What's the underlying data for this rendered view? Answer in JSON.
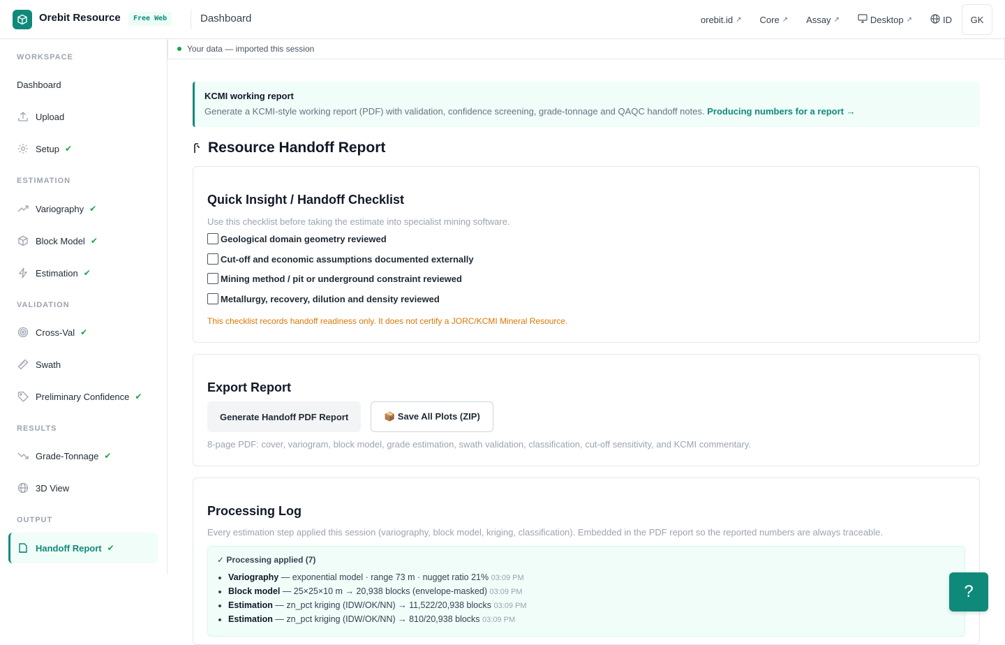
{
  "header": {
    "brand": "Orebit Resource",
    "plan_badge": "Free Web",
    "page": "Dashboard",
    "links": [
      {
        "label": "orebit.id",
        "ext": "↗"
      },
      {
        "label": "Core",
        "ext": "↗"
      },
      {
        "label": "Assay",
        "ext": "↗"
      },
      {
        "label": "Desktop",
        "ext": "↗"
      },
      {
        "label": "ID",
        "ext": ""
      }
    ],
    "user_initials": "GK"
  },
  "sidebar": {
    "sections": {
      "workspace": "WORKSPACE",
      "estimation": "ESTIMATION",
      "validation": "VALIDATION",
      "results": "RESULTS",
      "output": "OUTPUT"
    },
    "items": [
      {
        "label": "Dashboard",
        "done": false
      },
      {
        "label": "Upload",
        "done": false
      },
      {
        "label": "Setup",
        "done": true
      },
      {
        "label": "Variography",
        "done": true
      },
      {
        "label": "Block Model",
        "done": true
      },
      {
        "label": "Estimation",
        "done": true
      },
      {
        "label": "Cross-Val",
        "done": true
      },
      {
        "label": "Swath",
        "done": false
      },
      {
        "label": "Preliminary Confidence",
        "done": true
      },
      {
        "label": "Grade-Tonnage",
        "done": true
      },
      {
        "label": "3D View",
        "done": false
      },
      {
        "label": "Handoff Report",
        "done": true,
        "active": true
      }
    ],
    "check_glyph": "✔"
  },
  "session": {
    "status": "Your data — imported this session"
  },
  "callout": {
    "title": "KCMI working report",
    "text": "Generate a KCMI-style working report (PDF) with validation, confidence screening, grade-tonnage and QAQC handoff notes.",
    "link": "Producing numbers for a report →"
  },
  "page_title": "Resource Handoff Report",
  "checklist": {
    "title": "Quick Insight / Handoff Checklist",
    "subtitle": "Use this checklist before taking the estimate into specialist mining software.",
    "items": [
      "Geological domain geometry reviewed",
      "Cut-off and economic assumptions documented externally",
      "Mining method / pit or underground constraint reviewed",
      "Metallurgy, recovery, dilution and density reviewed"
    ],
    "warning": "This checklist records handoff readiness only. It does not certify a JORC/KCMI Mineral Resource."
  },
  "export": {
    "title": "Export Report",
    "primary_button": "Generate Handoff PDF Report",
    "secondary_button": "📦 Save All Plots (ZIP)",
    "note": "8-page PDF: cover, variogram, block model, grade estimation, swath validation, classification, cut-off sensitivity, and KCMI commentary."
  },
  "log": {
    "title": "Processing Log",
    "subtitle": "Every estimation step applied this session (variography, block model, kriging, classification). Embedded in the PDF report so the reported numbers are always traceable.",
    "box_title": "✓ Processing applied (7)",
    "entries": [
      {
        "step": "Variography",
        "detail": " — exponential model · range 73 m · nugget ratio 21% ",
        "time": "03:09 PM"
      },
      {
        "step": "Block model",
        "detail": " — 25×25×10 m → 20,938 blocks (envelope-masked) ",
        "time": "03:09 PM"
      },
      {
        "step": "Estimation",
        "detail": " — zn_pct kriging (IDW/OK/NN) → 11,522/20,938 blocks ",
        "time": "03:09 PM"
      },
      {
        "step": "Estimation",
        "detail": " — zn_pct kriging (IDW/OK/NN) → 810/20,938 blocks ",
        "time": "03:09 PM"
      }
    ]
  },
  "help_label": "?",
  "colors": {
    "accent": "#0f8a7a",
    "check": "#16a34a",
    "warning": "#d97706"
  }
}
